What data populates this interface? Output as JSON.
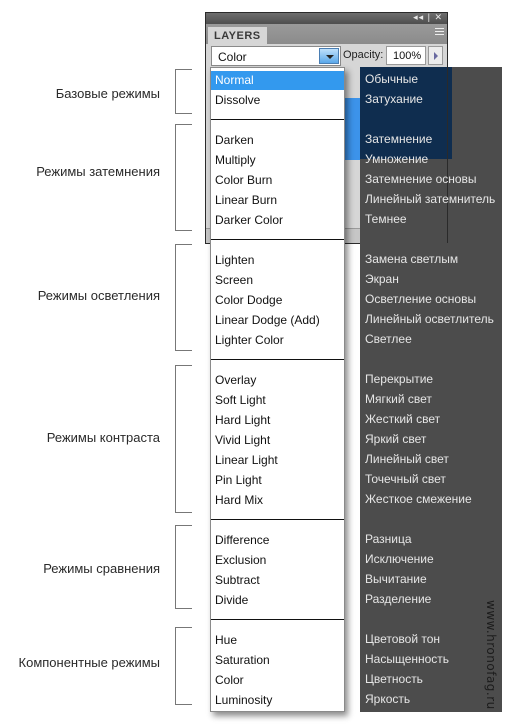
{
  "panel": {
    "tab_label": "LAYERS",
    "titlebar_buttons": "◂◂ | ✕",
    "blend_mode_value": "Color",
    "opacity_label": "Opacity:",
    "opacity_value": "100%",
    "background_partial_text": "100%"
  },
  "dropdown": {
    "selected": "Normal",
    "groups": [
      {
        "items": [
          "Normal",
          "Dissolve"
        ]
      },
      {
        "items": [
          "Darken",
          "Multiply",
          "Color Burn",
          "Linear Burn",
          "Darker Color"
        ]
      },
      {
        "items": [
          "Lighten",
          "Screen",
          "Color Dodge",
          "Linear Dodge (Add)",
          "Lighter Color"
        ]
      },
      {
        "items": [
          "Overlay",
          "Soft Light",
          "Hard Light",
          "Vivid Light",
          "Linear Light",
          "Pin Light",
          "Hard Mix"
        ]
      },
      {
        "items": [
          "Difference",
          "Exclusion",
          "Subtract",
          "Divide"
        ]
      },
      {
        "items": [
          "Hue",
          "Saturation",
          "Color",
          "Luminosity"
        ]
      }
    ]
  },
  "translations": {
    "groups": [
      {
        "items": [
          "Обычные",
          "Затухание"
        ]
      },
      {
        "items": [
          "Затемнение",
          "Умножение",
          "Затемнение основы",
          "Линейный затемнитель",
          "Темнее"
        ]
      },
      {
        "items": [
          "Замена светлым",
          "Экран",
          "Осветление основы",
          "Линейный осветлитель",
          "Светлее"
        ]
      },
      {
        "items": [
          "Перекрытие",
          "Мягкий свет",
          "Жесткий свет",
          "Яркий свет",
          "Линейный свет",
          "Точечный свет",
          "Жесткое смежение"
        ]
      },
      {
        "items": [
          "Разница",
          "Исключение",
          "Вычитание",
          "Разделение"
        ]
      },
      {
        "items": [
          "Цветовой тон",
          "Насыщенность",
          "Цветность",
          "Яркость"
        ]
      }
    ]
  },
  "group_labels": [
    "Базовые режимы",
    "Режимы затемнения",
    "Режимы осветления",
    "Режимы контраста",
    "Режимы сравнения",
    "Компонентные режимы"
  ],
  "watermark": "www.hronofag.ru",
  "colors": {
    "selection_blue": "#3399ee",
    "dark_column": "#4c4c4c",
    "dark_highlight": "#0f2d4f"
  }
}
